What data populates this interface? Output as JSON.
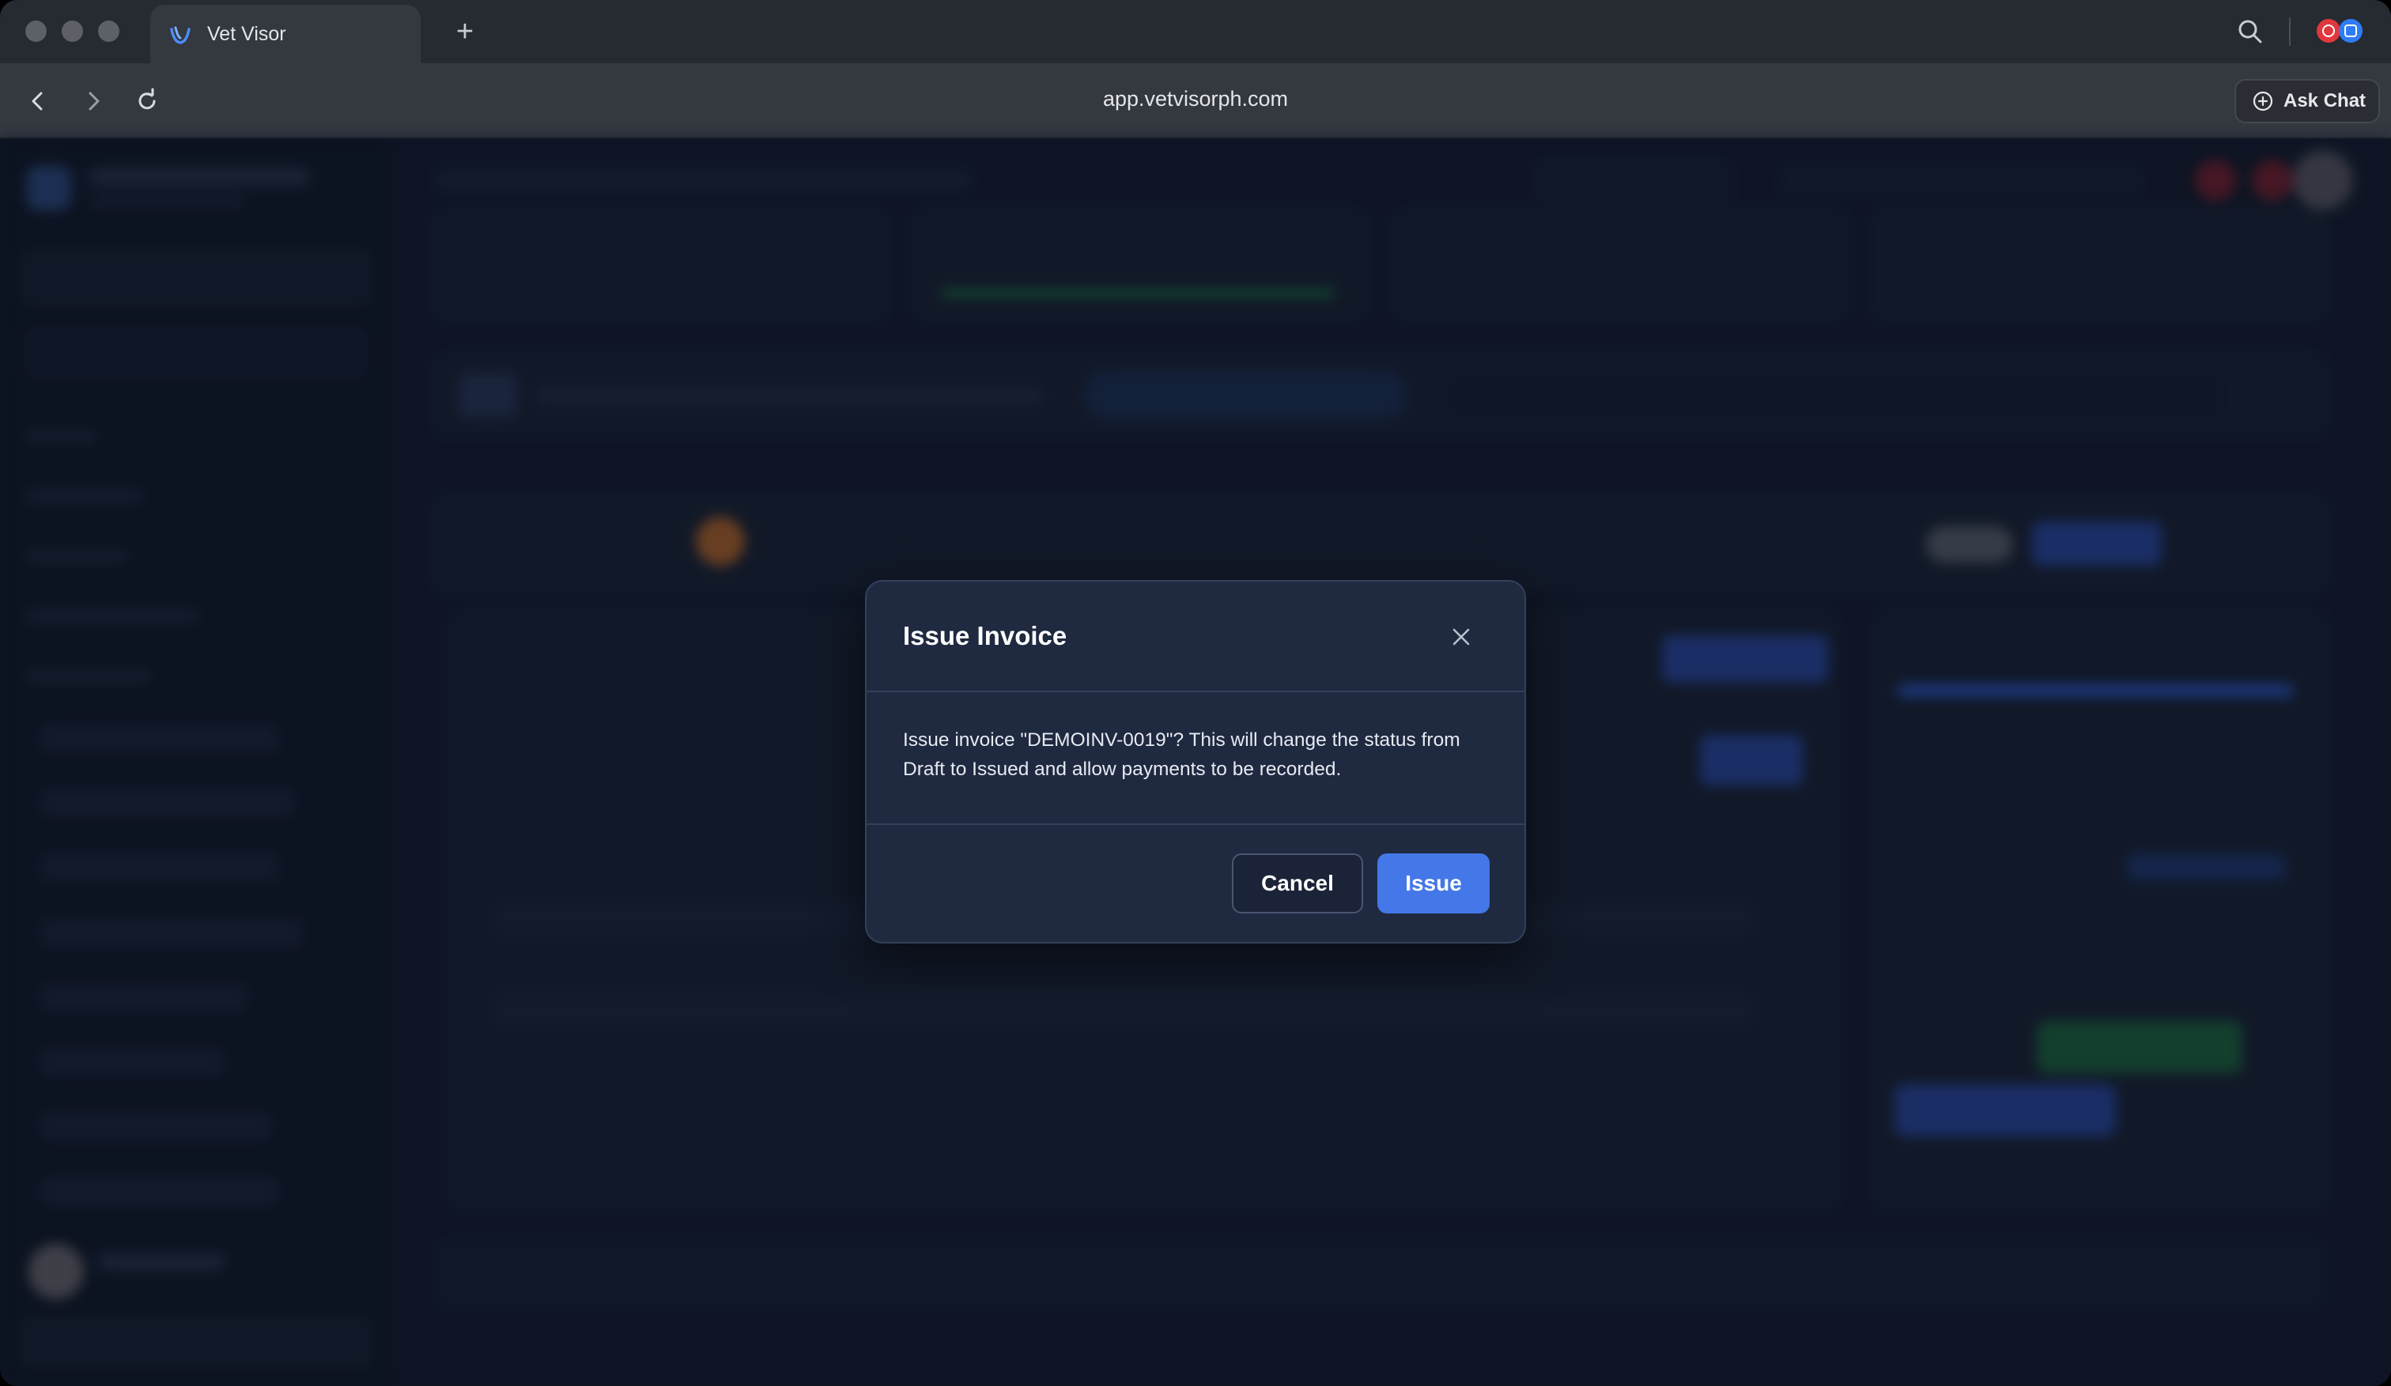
{
  "browser": {
    "tab_title": "Vet Visor",
    "url": "app.vetvisorph.com",
    "ask_chat_label": "Ask Chat"
  },
  "dialog": {
    "title": "Issue Invoice",
    "message": "Issue invoice \"DEMOINV-0019\"? This will change the status from Draft to Issued and allow payments to be recorded.",
    "cancel_label": "Cancel",
    "confirm_label": "Issue"
  },
  "colors": {
    "primary": "#4477e8",
    "background": "#141c2f",
    "dialog_bg": "#1f2940"
  }
}
